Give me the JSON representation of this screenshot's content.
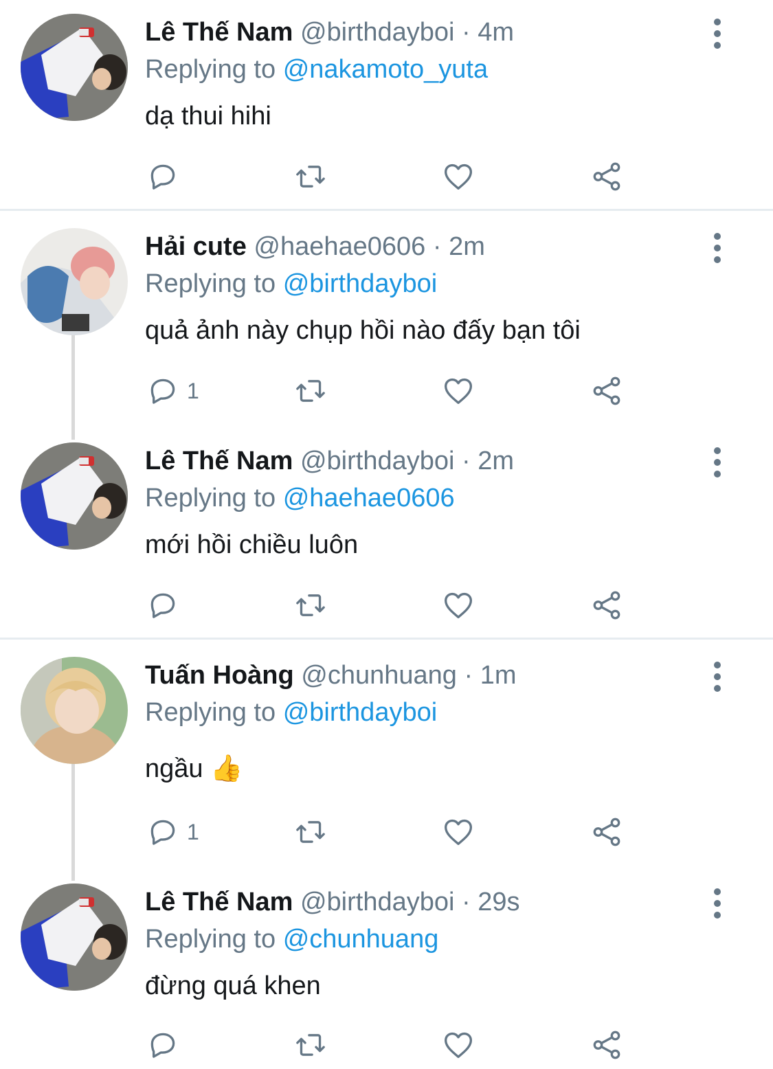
{
  "colors": {
    "accent": "#1b95e0",
    "secondary_text": "#657786",
    "primary_text": "#14171a",
    "divider": "#e6ecf0",
    "thread_line": "#d9d9d9"
  },
  "icons": {
    "reply": "reply-icon",
    "retweet": "retweet-icon",
    "like": "heart-icon",
    "share": "share-icon",
    "more": "more-vertical-icon"
  },
  "tweets": [
    {
      "name": "Lê Thế Nam",
      "handle": "@birthdayboi",
      "sep": "·",
      "time": "4m",
      "replying_label": "Replying to",
      "replying_to": "@nakamoto_yuta",
      "text": "dạ thui hihi",
      "reply_count": ""
    },
    {
      "name": "Hải cute",
      "handle": "@haehae0606",
      "sep": "·",
      "time": "2m",
      "replying_label": "Replying to",
      "replying_to": "@birthdayboi",
      "text": "quả ảnh này chụp hồi nào đấy bạn tôi",
      "reply_count": "1"
    },
    {
      "name": "Lê Thế Nam",
      "handle": "@birthdayboi",
      "sep": "·",
      "time": "2m",
      "replying_label": "Replying to",
      "replying_to": "@haehae0606",
      "text": "mới hồi chiều luôn",
      "reply_count": ""
    },
    {
      "name": "Tuấn Hoàng",
      "handle": "@chunhuang",
      "sep": "·",
      "time": "1m",
      "replying_label": "Replying to",
      "replying_to": "@birthdayboi",
      "text": "ngầu",
      "emoji": "👍",
      "reply_count": "1"
    },
    {
      "name": "Lê Thế Nam",
      "handle": "@birthdayboi",
      "sep": "·",
      "time": "29s",
      "replying_label": "Replying to",
      "replying_to": "@chunhuang",
      "text": "đừng quá khen",
      "reply_count": ""
    }
  ]
}
